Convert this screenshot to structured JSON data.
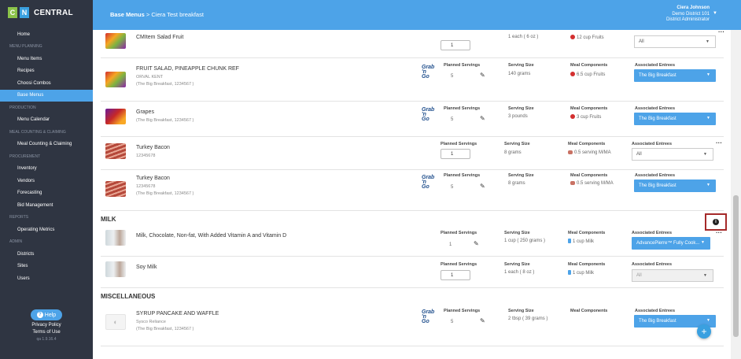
{
  "app": {
    "logo_c": "C",
    "logo_n": "N",
    "logo_text": "CENTRAL"
  },
  "sidebar": {
    "home": "Home",
    "menu_planning": "MENU PLANNING",
    "menu_items": "Menu Items",
    "recipes": "Recipes",
    "choosi_combos": "Choosi Combos",
    "base_menus": "Base Menus",
    "production": "PRODUCTION",
    "menu_calendar": "Menu Calendar",
    "meal_counting_section": "MEAL COUNTING & CLAIMING",
    "meal_counting": "Meal Counting & Claiming",
    "procurement": "PROCUREMENT",
    "inventory": "Inventory",
    "vendors": "Vendors",
    "forecasting": "Forecasting",
    "bid_management": "Bid Management",
    "reports": "REPORTS",
    "operating_metrics": "Operating Metrics",
    "admin": "ADMIN",
    "districts": "Districts",
    "sites": "Sites",
    "users": "Users",
    "help": "Help",
    "privacy": "Privacy Policy",
    "terms": "Terms of Use",
    "version": "qa 1.9.16.4"
  },
  "header": {
    "crumb_root": "Base Menus",
    "crumb_sep": ">",
    "crumb_current": "Ciera Test breakfast",
    "user_name": "Ciera Johnson",
    "user_district": "Demo District 101",
    "user_role": "District Administrator"
  },
  "labels": {
    "planned": "Planned Servings",
    "serving": "Serving Size",
    "meal": "Meal Components",
    "entrees": "Associated Entrees",
    "grab1": "Grab",
    "grab2": "'n",
    "grab3": "Go"
  },
  "sections": {
    "milk": "MILK",
    "misc": "MISCELLANEOUS"
  },
  "rows": [
    {
      "name": "CMItem Salad Fruit",
      "qty": "1",
      "serving": "1 each ( 6 oz )",
      "meal": "12 cup Fruits",
      "entree": "All"
    },
    {
      "name": "FRUIT SALAD, PINEAPPLE CHUNK REF",
      "sub1": "ORVAL KENT",
      "sub2": "(The Big Breakfast, 1234567 )",
      "qty": "5",
      "serving": "140 grams",
      "meal": "6.5 cup Fruits",
      "entree": "The Big Breakfast"
    },
    {
      "name": "Grapes",
      "sub1": "(The Big Breakfast, 1234567 )",
      "qty": "5",
      "serving": "3 pounds",
      "meal": "3 cup Fruits",
      "entree": "The Big Breakfast"
    },
    {
      "name": "Turkey Bacon",
      "sub1": "12345678",
      "qty": "1",
      "serving": "8 grams",
      "meal": "0.5 serving M/MA",
      "entree": "All"
    },
    {
      "name": "Turkey Bacon",
      "sub1": "12345678",
      "sub2": "(The Big Breakfast, 1234567 )",
      "qty": "5",
      "serving": "8 grams",
      "meal": "0.5 serving M/MA",
      "entree": "The Big Breakfast"
    },
    {
      "name": "Milk, Chocolate, Non-fat, With Added Vitamin A and Vitamin D",
      "qty": "1",
      "serving": "1 cup ( 250 grams )",
      "meal": "1 cup Milk",
      "entree": "AdvancePierre™ Fully Cook..."
    },
    {
      "name": "Soy Milk",
      "qty": "1",
      "serving": "1 each ( 8 oz )",
      "meal": "1 cup Milk",
      "entree": "All"
    },
    {
      "name": "SYRUP PANCAKE AND WAFFLE",
      "sub1": "Sysco Reliance",
      "sub2": "(The Big Breakfast, 1234567 )",
      "qty": "5",
      "serving": "2 tbsp ( 39 grams )",
      "meal": "",
      "entree": "The Big Breakfast"
    }
  ],
  "icons": {
    "pencil": "✎",
    "chevron": "▼",
    "dots": "···",
    "plus": "+",
    "info": "i",
    "camera": "◐"
  }
}
